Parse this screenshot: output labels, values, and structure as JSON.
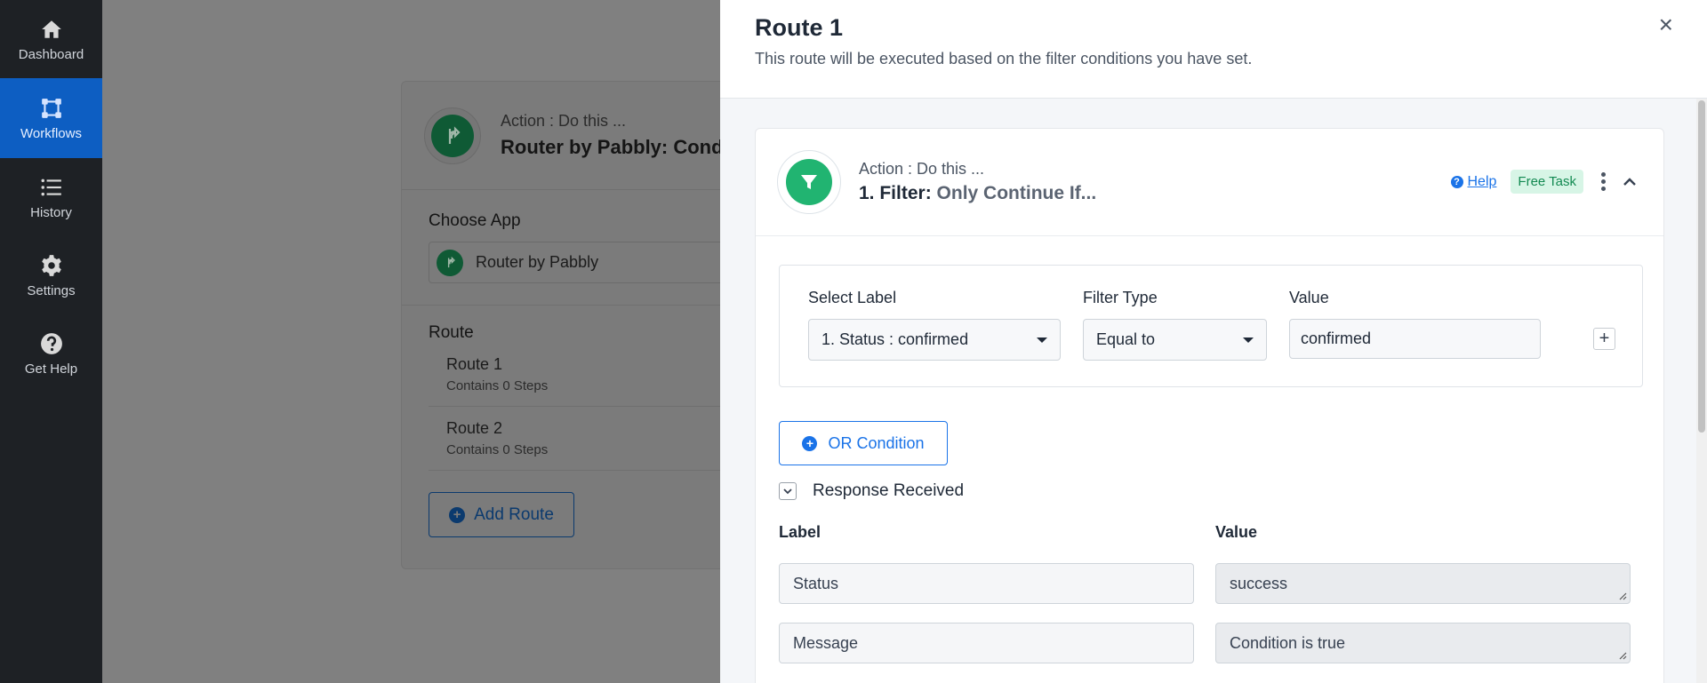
{
  "sidebar": {
    "items": [
      {
        "label": "Dashboard",
        "icon": "home-icon"
      },
      {
        "label": "Workflows",
        "icon": "workflow-icon",
        "active": true
      },
      {
        "label": "History",
        "icon": "history-icon"
      },
      {
        "label": "Settings",
        "icon": "gear-icon"
      },
      {
        "label": "Get Help",
        "icon": "question-icon"
      }
    ]
  },
  "background": {
    "action_label": "Action : Do this ...",
    "app_title": "Router by Pabbly: Cond",
    "choose_app_label": "Choose App",
    "selected_app": "Router by Pabbly",
    "route_heading": "Route",
    "routes": [
      {
        "name": "Route 1",
        "steps": "Contains 0 Steps"
      },
      {
        "name": "Route 2",
        "steps": "Contains 0 Steps"
      }
    ],
    "add_route_label": "Add Route"
  },
  "panel": {
    "title": "Route 1",
    "subtitle": "This route will be executed based on the filter conditions you have set.",
    "close_glyph": "×",
    "step": {
      "action_label": "Action : Do this ...",
      "title_prefix": "1. Filter:",
      "title_suffix": "Only Continue If...",
      "help_label": "Help",
      "badge": "Free Task"
    },
    "filter": {
      "select_label_heading": "Select Label",
      "select_label_value": "1. Status : confirmed",
      "filter_type_heading": "Filter Type",
      "filter_type_value": "Equal to",
      "value_heading": "Value",
      "value": "confirmed"
    },
    "or_condition_label": "OR Condition",
    "response_received_label": "Response Received",
    "response": {
      "label_heading": "Label",
      "value_heading": "Value",
      "rows": [
        {
          "label": "Status",
          "value": "success"
        },
        {
          "label": "Message",
          "value": "Condition is true"
        }
      ]
    }
  },
  "colors": {
    "accent": "#1a73e8",
    "sidebar_bg": "#1e2125",
    "sidebar_active": "#0d5ec2",
    "filter_green": "#21b471",
    "badge_bg": "#d7f5e6",
    "badge_text": "#138a52"
  }
}
